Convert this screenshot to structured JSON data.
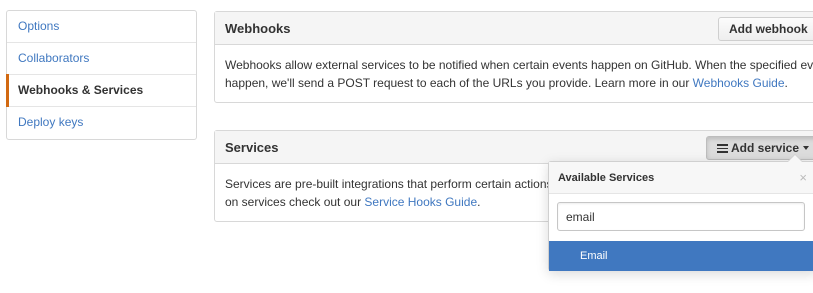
{
  "sidebar": {
    "items": [
      {
        "label": "Options"
      },
      {
        "label": "Collaborators"
      },
      {
        "label": "Webhooks & Services"
      },
      {
        "label": "Deploy keys"
      }
    ]
  },
  "webhooks": {
    "title": "Webhooks",
    "add_button": "Add webhook",
    "description_line1": "Webhooks allow external services to be notified when certain events happen on GitHub. When the specified events",
    "description_line2": "happen, we'll send a POST request to each of the URLs you provide. Learn more in our ",
    "guide_link": "Webhooks Guide",
    "trailing": "."
  },
  "services": {
    "title": "Services",
    "add_button": "Add service",
    "description_line1": "Services are pre-built integrations that perform certain actions w",
    "description_line2": "on services check out our ",
    "guide_link": "Service Hooks Guide",
    "trailing": "."
  },
  "dropdown": {
    "title": "Available Services",
    "close": "×",
    "search_value": "email",
    "results": [
      {
        "label": "Email"
      }
    ]
  },
  "colors": {
    "link": "#4078c0",
    "selected_marker": "#d26911",
    "highlight": "#4078c0"
  }
}
